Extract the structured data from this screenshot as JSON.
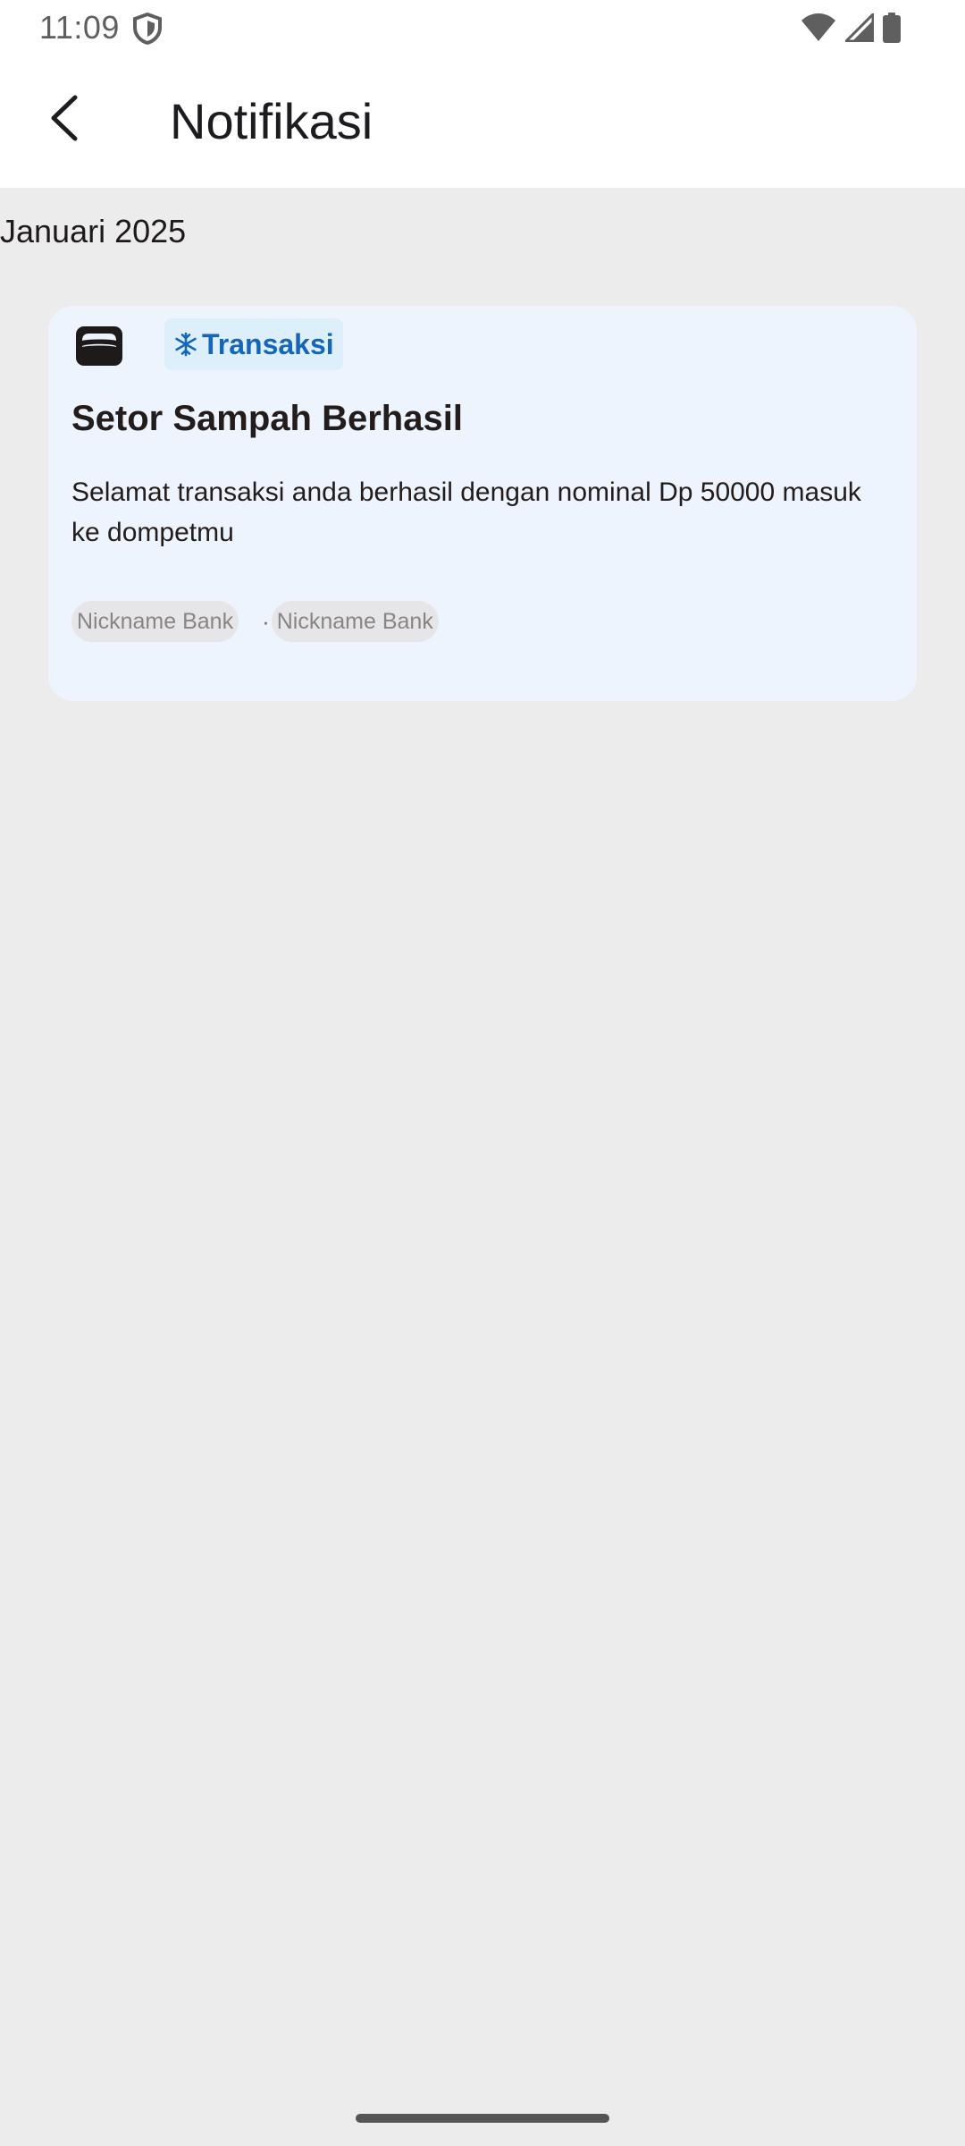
{
  "status_bar": {
    "time": "11:09",
    "icons": [
      "shield-icon",
      "wifi-icon",
      "cellular-signal-icon",
      "battery-icon"
    ]
  },
  "app_bar": {
    "back_icon": "arrow-back-icon",
    "title": "Notifikasi"
  },
  "section": {
    "month": "Januari 2025"
  },
  "notification": {
    "icon": "wallet-icon",
    "category_icon": "snowflake-icon",
    "category": "Transaksi",
    "title": "Setor Sampah Berhasil",
    "message": "Selamat transaksi anda berhasil dengan nominal Dp 50000 masuk ke dompetmu",
    "tags": [
      "Nickname Bank",
      "Nickname Bank"
    ],
    "separator": "·"
  },
  "colors": {
    "background": "#ececec",
    "card_background": "#eef4fd",
    "chip_background": "#ddeffb",
    "accent": "#1565b8",
    "text_primary": "#231c1c",
    "tag_background": "#e6e6e8",
    "tag_text": "#8a8585"
  }
}
